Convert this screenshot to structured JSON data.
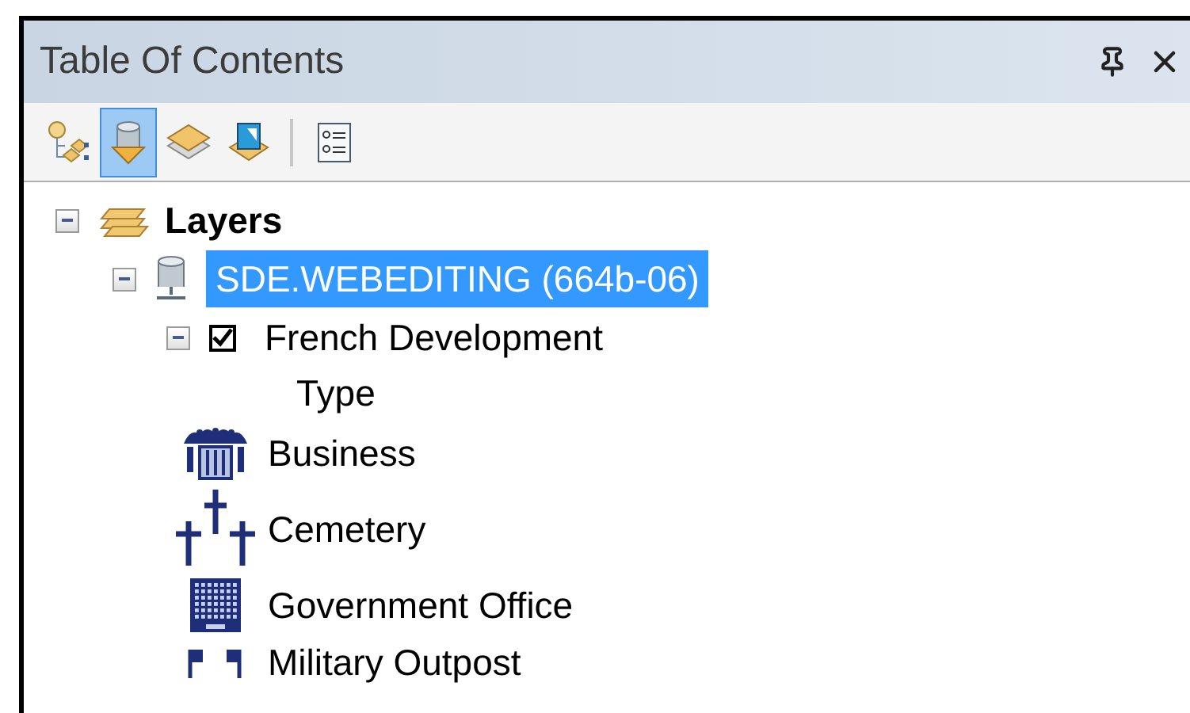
{
  "window": {
    "title": "Table Of Contents"
  },
  "toolbar": [
    {
      "kind": "draw-order",
      "selected": false
    },
    {
      "kind": "source",
      "selected": true
    },
    {
      "kind": "visibility",
      "selected": false
    },
    {
      "kind": "selection",
      "selected": false
    },
    {
      "kind": "separator",
      "selected": false
    },
    {
      "kind": "options",
      "selected": false
    }
  ],
  "tree": {
    "label": "Layers",
    "expanded": true,
    "children": [
      {
        "label": "SDE.WEBEDITING (664b-06)",
        "selected": true,
        "expanded": true,
        "children": [
          {
            "label": "French Development",
            "checked": true,
            "expanded": true,
            "legend": {
              "heading": "Type",
              "classes": [
                {
                  "label": "Business",
                  "kind": "business"
                },
                {
                  "label": "Cemetery",
                  "kind": "cemetery"
                },
                {
                  "label": "Government Office",
                  "kind": "government"
                },
                {
                  "label": "Military Outpost",
                  "kind": "military"
                }
              ]
            }
          }
        ]
      }
    ]
  }
}
